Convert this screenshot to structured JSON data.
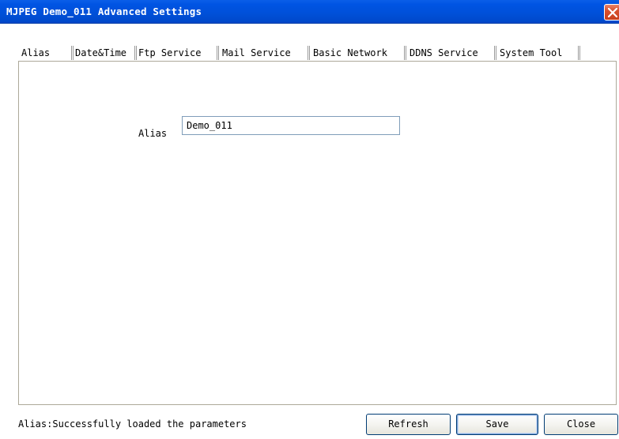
{
  "window": {
    "title": "MJPEG Demo_011 Advanced Settings",
    "close_icon": "close-icon"
  },
  "tabs": [
    {
      "label": "Alias",
      "active": true
    },
    {
      "label": "Date&Time",
      "active": false
    },
    {
      "label": "Ftp Service",
      "active": false
    },
    {
      "label": "Mail Service",
      "active": false
    },
    {
      "label": "Basic Network",
      "active": false
    },
    {
      "label": "DDNS Service",
      "active": false
    },
    {
      "label": "System Tool",
      "active": false
    }
  ],
  "form": {
    "alias_label": "Alias",
    "alias_value": "Demo_011"
  },
  "status": {
    "message": "Alias:Successfully loaded the parameters"
  },
  "buttons": {
    "refresh": "Refresh",
    "save": "Save",
    "close": "Close"
  },
  "colors": {
    "titlebar": "#0054e3",
    "close_button": "#d8502c",
    "button_border": "#003c74"
  }
}
